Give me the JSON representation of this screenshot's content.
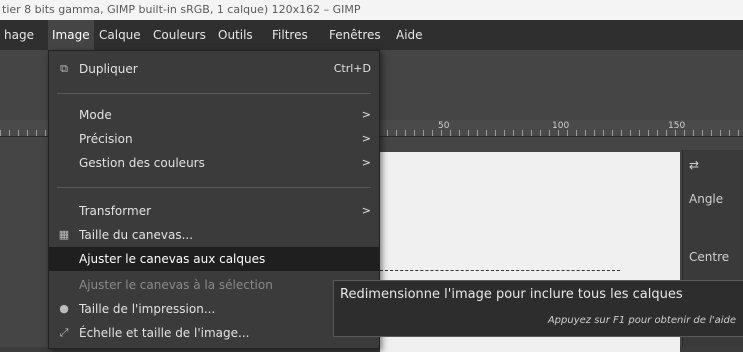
{
  "window": {
    "title": "tier 8 bits gamma, GIMP built-in sRGB, 1 calque) 120x162 – GIMP"
  },
  "menubar": {
    "items": [
      {
        "label": "hage"
      },
      {
        "label": "Image"
      },
      {
        "label": "Calque"
      },
      {
        "label": "Couleurs"
      },
      {
        "label": "Outils"
      },
      {
        "label": "Filtres"
      },
      {
        "label": "Fenêtres"
      },
      {
        "label": "Aide"
      }
    ]
  },
  "image_menu": {
    "dupliquer": {
      "label": "Dupliquer",
      "shortcut": "Ctrl+D",
      "icon": "duplicate-icon"
    },
    "mode": {
      "label": "Mode",
      "arrow": ">"
    },
    "precision": {
      "label": "Précision",
      "arrow": ">"
    },
    "gestion": {
      "label": "Gestion des couleurs",
      "arrow": ">"
    },
    "transformer": {
      "label": "Transformer",
      "arrow": ">"
    },
    "taille_canevas": {
      "label": "Taille du canevas...",
      "icon": "canvas-size-icon"
    },
    "ajuster_calques": {
      "label": "Ajuster le canevas aux calques"
    },
    "ajuster_selection": {
      "label": "Ajuster le canevas à la sélection"
    },
    "taille_impression": {
      "label": "Taille de l'impression...",
      "icon": "print-size-icon"
    },
    "echelle": {
      "label": "Échelle et taille de l'image...",
      "icon": "scale-icon"
    }
  },
  "ruler": {
    "labels": [
      "50",
      "100",
      "150"
    ]
  },
  "tool_options": {
    "angle": "Angle",
    "centre": "Centre"
  },
  "tooltip": {
    "text": "Redimensionne l'image pour inclure tous les calques",
    "help": "Appuyez sur F1 pour obtenir de l'aide"
  }
}
